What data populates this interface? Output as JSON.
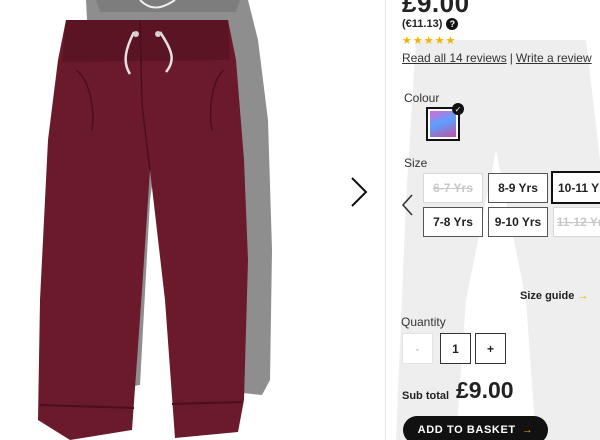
{
  "product": {
    "price": "£9.00",
    "price_euro": "(€11.13)",
    "help_icon_glyph": "?",
    "rating_stars": "★★★★★",
    "rating_value": 5,
    "reviews_link": "Read all 14 reviews",
    "reviews_separator": "|",
    "write_review_link": "Write a review"
  },
  "colour": {
    "label": "Colour",
    "selected_check": "✓",
    "swatch_colors": [
      "#d86bd0",
      "#5aa0ff",
      "#c2509e"
    ]
  },
  "size": {
    "label": "Size",
    "options": [
      {
        "label": "6-7 Yrs",
        "state": "disabled"
      },
      {
        "label": "8-9 Yrs",
        "state": "available"
      },
      {
        "label": "10-11 Yrs",
        "state": "selected"
      },
      {
        "label": "7-8 Yrs",
        "state": "available"
      },
      {
        "label": "9-10 Yrs",
        "state": "available"
      },
      {
        "label": "11-12 Yrs",
        "state": "disabled"
      }
    ],
    "guide_link": "Size guide",
    "guide_arrow": "→"
  },
  "quantity": {
    "label": "Quantity",
    "minus": "-",
    "value": "1",
    "plus": "+"
  },
  "subtotal": {
    "label": "Sub total",
    "value": "£9.00"
  },
  "basket": {
    "label": "ADD TO BASKET",
    "arrow": "→"
  },
  "icons": {
    "gallery_next": "chevron-right-icon",
    "size_prev": "chevron-left-icon"
  },
  "colors": {
    "accent": "#f2a900",
    "stars": "#f5b301",
    "primary_text": "#222222",
    "button_bg": "#111111",
    "trousers_main": "#6b1a2b",
    "trousers_back": "#8c8c8c"
  }
}
